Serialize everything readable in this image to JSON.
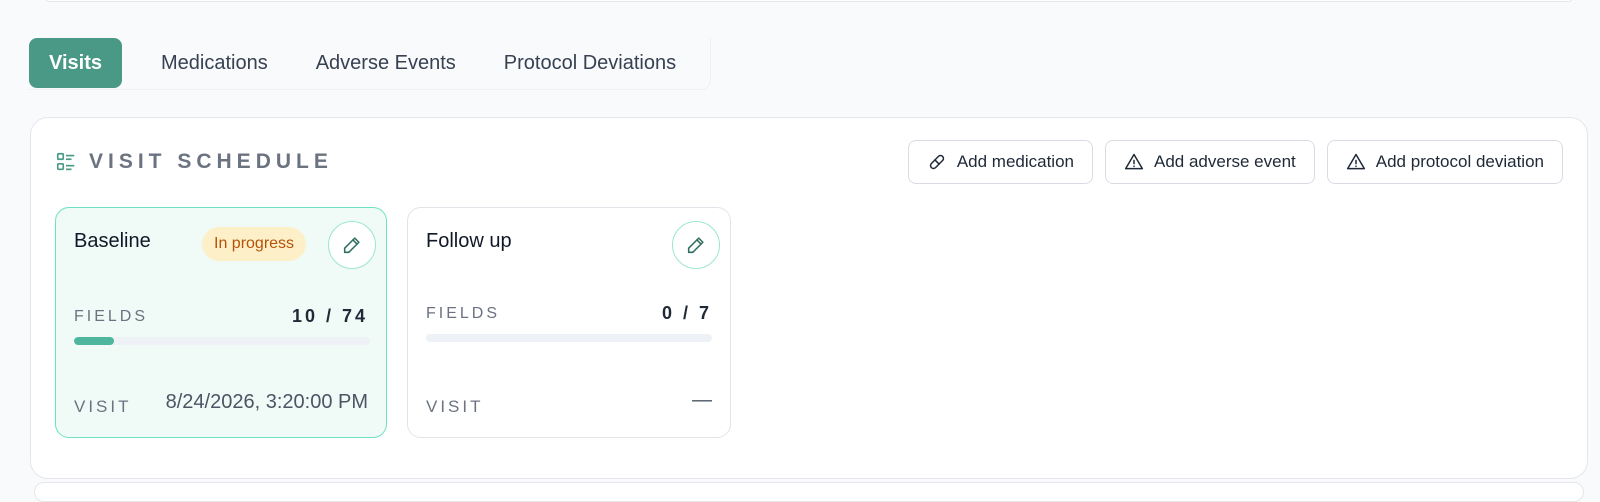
{
  "tabs": [
    {
      "label": "Visits",
      "active": true
    },
    {
      "label": "Medications",
      "active": false
    },
    {
      "label": "Adverse Events",
      "active": false
    },
    {
      "label": "Protocol Deviations",
      "active": false
    }
  ],
  "section": {
    "icon": "list-details-icon",
    "title": "VISIT SCHEDULE"
  },
  "actions": [
    {
      "label": "Add medication",
      "icon": "pill-icon"
    },
    {
      "label": "Add adverse event",
      "icon": "warning-triangle-icon"
    },
    {
      "label": "Add protocol deviation",
      "icon": "warning-triangle-icon"
    }
  ],
  "visits": [
    {
      "title": "Baseline",
      "status": "In progress",
      "fields_label": "FIELDS",
      "fields_count": "10 / 74",
      "progress_fraction": 0.135,
      "visit_label": "VISIT",
      "visit_value": "8/24/2026, 3:20:00 PM",
      "edit_icon": "pencil-icon"
    },
    {
      "title": "Follow up",
      "fields_label": "FIELDS",
      "fields_count": "0 / 7",
      "progress_fraction": 0,
      "visit_label": "VISIT",
      "visit_value": "—",
      "edit_icon": "pencil-icon"
    }
  ],
  "colors": {
    "primary": "#4a9886",
    "progress": "#4fb59c",
    "active_card_bg": "#f0fbf8",
    "active_card_border": "#6ee0c3",
    "badge_bg": "#fdf0c8",
    "badge_text": "#b45309"
  }
}
